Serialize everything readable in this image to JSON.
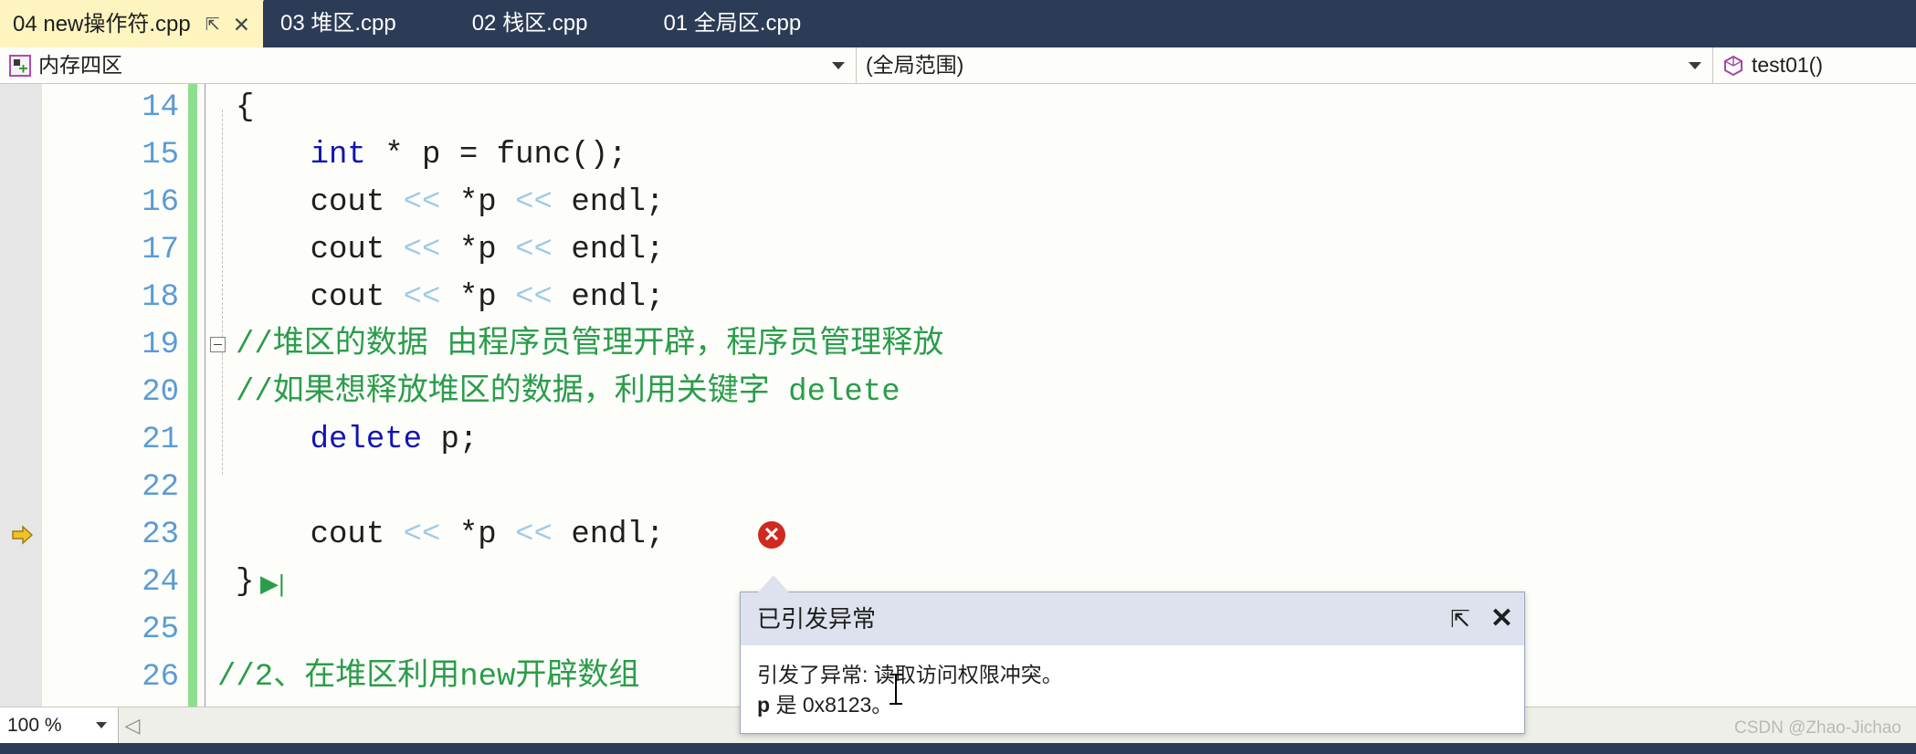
{
  "window": {
    "accent_dark": "#2d3c56",
    "active_tab_bg": "#fdf4bf",
    "editor_bg": "#fdfdfa"
  },
  "tabs": [
    {
      "label": "04 new操作符.cpp",
      "active": true,
      "pin_icon": "pin-icon",
      "close_icon": "close-icon",
      "pin_glyph": "⇱",
      "close_glyph": "✕"
    },
    {
      "label": "03 堆区.cpp",
      "active": false
    },
    {
      "label": "02 栈区.cpp",
      "active": false
    },
    {
      "label": "01 全局区.cpp",
      "active": false
    }
  ],
  "navbar": {
    "project_combo": {
      "icon": "memory-region-icon",
      "value": "内存四区"
    },
    "scope_combo": {
      "value": "(全局范围)"
    },
    "function_combo": {
      "icon": "function-cube-icon",
      "value": "test01()"
    }
  },
  "editor": {
    "lines": [
      {
        "no": "14",
        "text": "{",
        "indent": 0,
        "marker": ""
      },
      {
        "no": "15",
        "text": "int * p = func();",
        "indent": 1,
        "marker": ""
      },
      {
        "no": "16",
        "text": "cout << *p << endl;",
        "indent": 1,
        "marker": ""
      },
      {
        "no": "17",
        "text": "cout << *p << endl;",
        "indent": 1,
        "marker": ""
      },
      {
        "no": "18",
        "text": "cout << *p << endl;",
        "indent": 1,
        "marker": ""
      },
      {
        "no": "19",
        "text": "//堆区的数据 由程序员管理开辟，程序员管理释放",
        "indent": 1,
        "marker": "fold"
      },
      {
        "no": "20",
        "text": "//如果想释放堆区的数据，利用关键字 delete",
        "indent": 1,
        "marker": ""
      },
      {
        "no": "21",
        "text": "delete p;",
        "indent": 1,
        "marker": ""
      },
      {
        "no": "22",
        "text": "",
        "indent": 1,
        "marker": ""
      },
      {
        "no": "23",
        "text": "cout << *p << endl;",
        "indent": 1,
        "marker": "current-statement"
      },
      {
        "no": "24",
        "text": "}",
        "indent": 0,
        "marker": "run-to-cursor"
      },
      {
        "no": "25",
        "text": "",
        "indent": 0,
        "marker": ""
      },
      {
        "no": "26",
        "text": "//2、在堆区利用new开辟数组",
        "indent": 0,
        "marker": ""
      }
    ],
    "error_glyph": {
      "name": "error-circle-icon",
      "glyph": "✕",
      "color": "#cf2a20"
    },
    "current_statement_arrow_color": "#e8b830",
    "change_bar_color": "#8ddf8d"
  },
  "exception_popup": {
    "title": "已引发异常",
    "pin_glyph": "⇱",
    "close_glyph": "✕",
    "message_line1": "引发了异常: 读取访问权限冲突。",
    "variable": "p",
    "message_line2": " 是 0x8123。"
  },
  "statusbar": {
    "zoom_value": "100 %",
    "scroll_left_glyph": "◁"
  },
  "watermark": "CSDN @Zhao-Jichao"
}
